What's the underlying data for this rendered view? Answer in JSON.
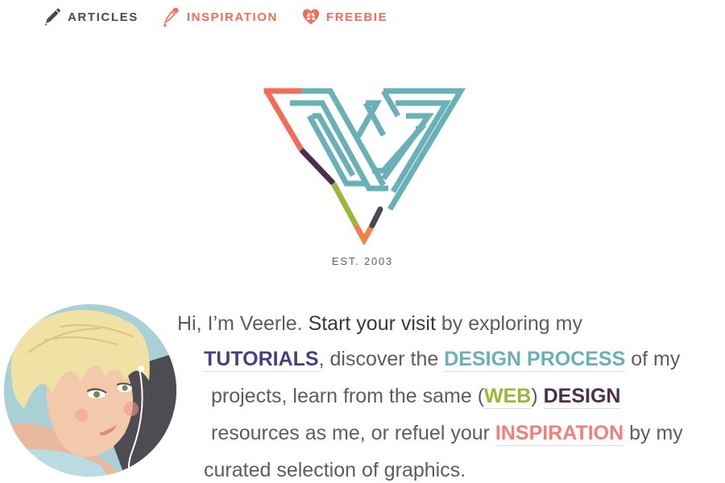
{
  "nav": {
    "items": [
      {
        "label": "ARTICLES",
        "icon": "pencil-icon"
      },
      {
        "label": "INSPIRATION",
        "icon": "eyedropper-icon"
      },
      {
        "label": "FREEBIE",
        "icon": "heart-gift-icon"
      }
    ]
  },
  "logo": {
    "est": "EST. 2003"
  },
  "intro": {
    "l1_a": "Hi, I’m Veerle. ",
    "l1_b": "Start your visit",
    "l1_c": " by exploring my",
    "tutorials": "TUTORIALS",
    "l2_b": ", discover the ",
    "design_process": "DESIGN PROCESS",
    "l2_d": " of my",
    "l3_a": "projects, learn from the same (",
    "web": "WEB",
    "l3_c": ") ",
    "design": "DESIGN",
    "l4_a": "resources as me, or refuel your ",
    "inspiration": "INSPIRATION",
    "l4_c": " by my",
    "l5": "curated selection of graphics."
  },
  "colors": {
    "accent_coral": "#f26c5a",
    "teal": "#69b1b6",
    "purple": "#4a3f7e",
    "green": "#98b83c",
    "plum": "#4d2e4a",
    "pink": "#f47f78",
    "text": "#5b5d62"
  }
}
